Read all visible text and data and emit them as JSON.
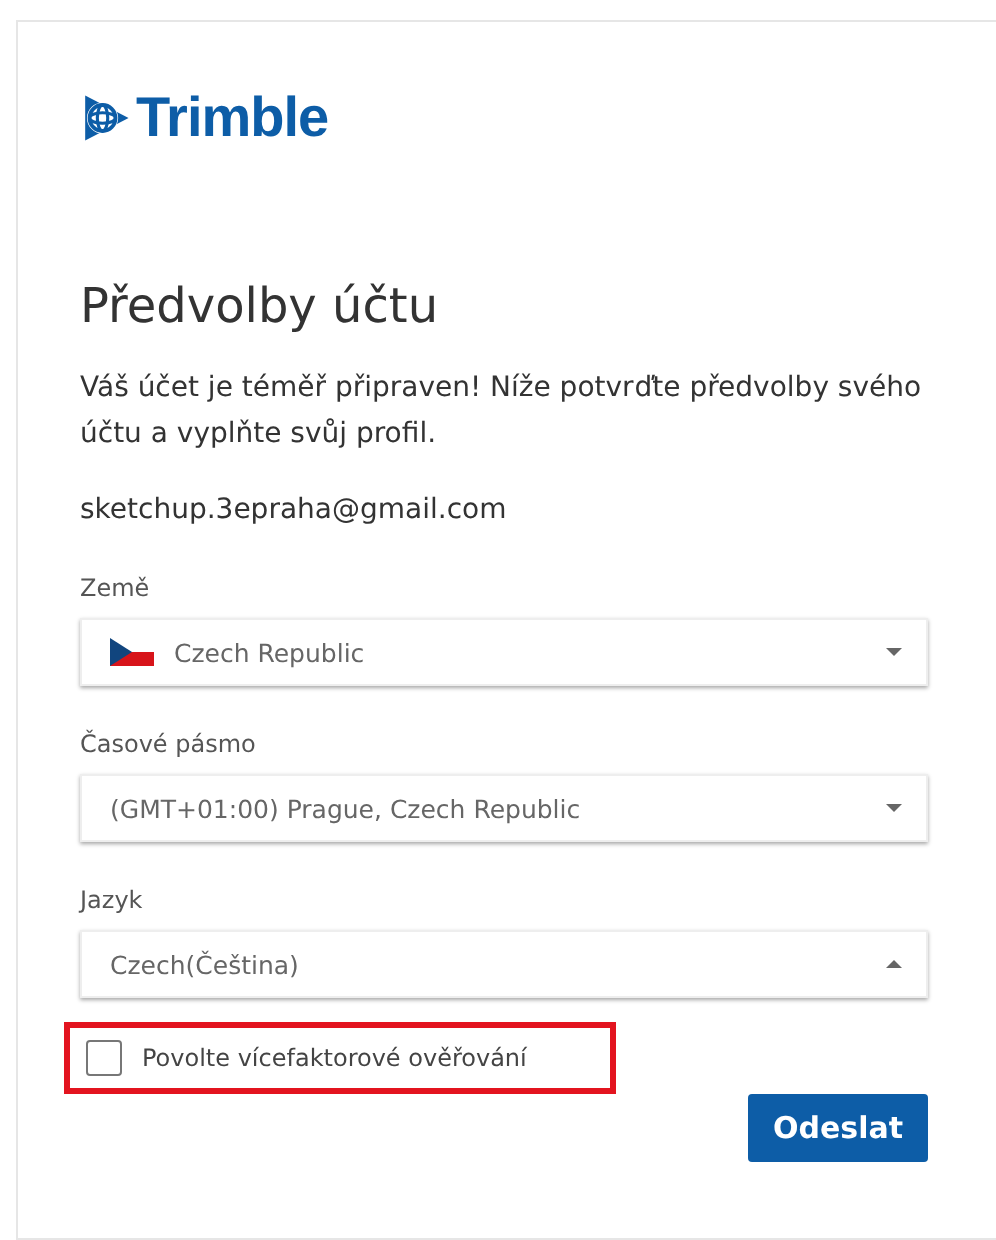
{
  "logo": {
    "text": "Trimble"
  },
  "title": "Předvolby účtu",
  "intro": "Váš účet je téměř připraven! Níže potvrďte předvolby svého účtu a vyplňte svůj profil.",
  "email": "sketchup.3epraha@gmail.com",
  "fields": [
    {
      "label": "Země",
      "value": "Czech Republic",
      "flag": true,
      "expanded": false
    },
    {
      "label": "Časové pásmo",
      "value": "(GMT+01:00) Prague, Czech Republic",
      "flag": false,
      "expanded": false
    },
    {
      "label": "Jazyk",
      "value": "Czech(Čeština)",
      "flag": false,
      "expanded": true
    }
  ],
  "mfa": {
    "label": "Povolte vícefaktorové ověřování",
    "checked": false,
    "highlighted": true
  },
  "submit": "Odeslat"
}
